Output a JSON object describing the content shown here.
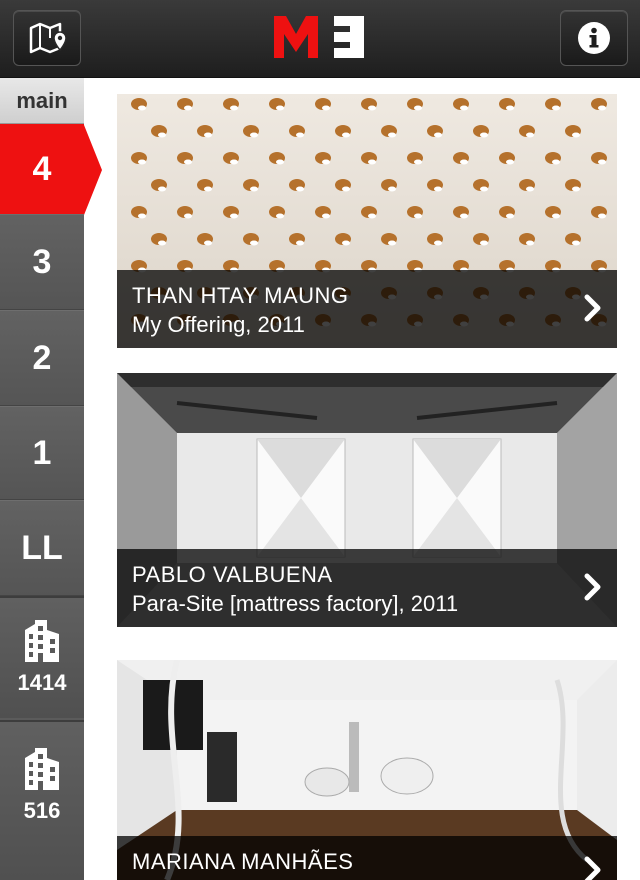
{
  "header": {
    "logo_text": "MF",
    "map_button_icon": "map-pin-icon",
    "info_button_icon": "info-icon"
  },
  "sidebar": {
    "title": "main",
    "floors": [
      {
        "label": "4",
        "active": true
      },
      {
        "label": "3",
        "active": false
      },
      {
        "label": "2",
        "active": false
      },
      {
        "label": "1",
        "active": false
      },
      {
        "label": "LL",
        "active": false
      }
    ],
    "buildings": [
      {
        "label": "1414",
        "icon": "building-icon"
      },
      {
        "label": "516",
        "icon": "building-icon"
      }
    ]
  },
  "artworks": [
    {
      "artist": "THAN HTAY MAUNG",
      "title": "My Offering, 2011"
    },
    {
      "artist": "PABLO VALBUENA",
      "title": "Para-Site [mattress factory], 2011"
    },
    {
      "artist": "MARIANA MANHÃES",
      "title": ""
    }
  ],
  "colors": {
    "accent": "#ee1111",
    "sidebar": "#5b5b5b",
    "topbar": "#2a2a2a"
  }
}
